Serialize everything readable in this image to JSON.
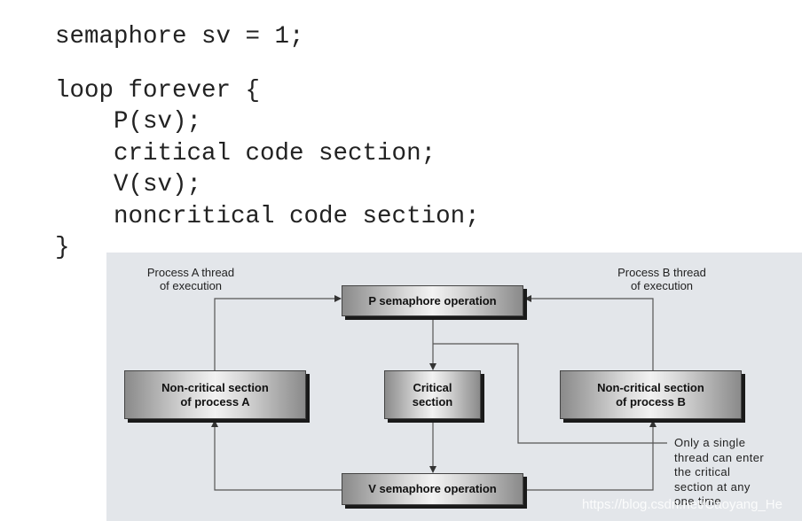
{
  "code": {
    "lines": [
      "semaphore sv = 1;",
      "loop forever {",
      "    P(sv);",
      "    critical code section;",
      "    V(sv);",
      "    noncritical code section;",
      "}"
    ]
  },
  "diagram": {
    "p_op": "P semaphore operation",
    "v_op": "V semaphore operation",
    "critical": [
      "Critical",
      "section"
    ],
    "noncrit_a": [
      "Non-critical section",
      "of process A"
    ],
    "noncrit_b": [
      "Non-critical section",
      "of process B"
    ],
    "label_a": [
      "Process A thread",
      "of execution"
    ],
    "label_b": [
      "Process B thread",
      "of execution"
    ],
    "note": [
      "Only a single",
      "thread can enter",
      "the critical",
      "section at any",
      "one time"
    ],
    "panel_color": "#e3e6ea"
  },
  "watermark": "https://blog.csdn.net/Caoyang_He"
}
